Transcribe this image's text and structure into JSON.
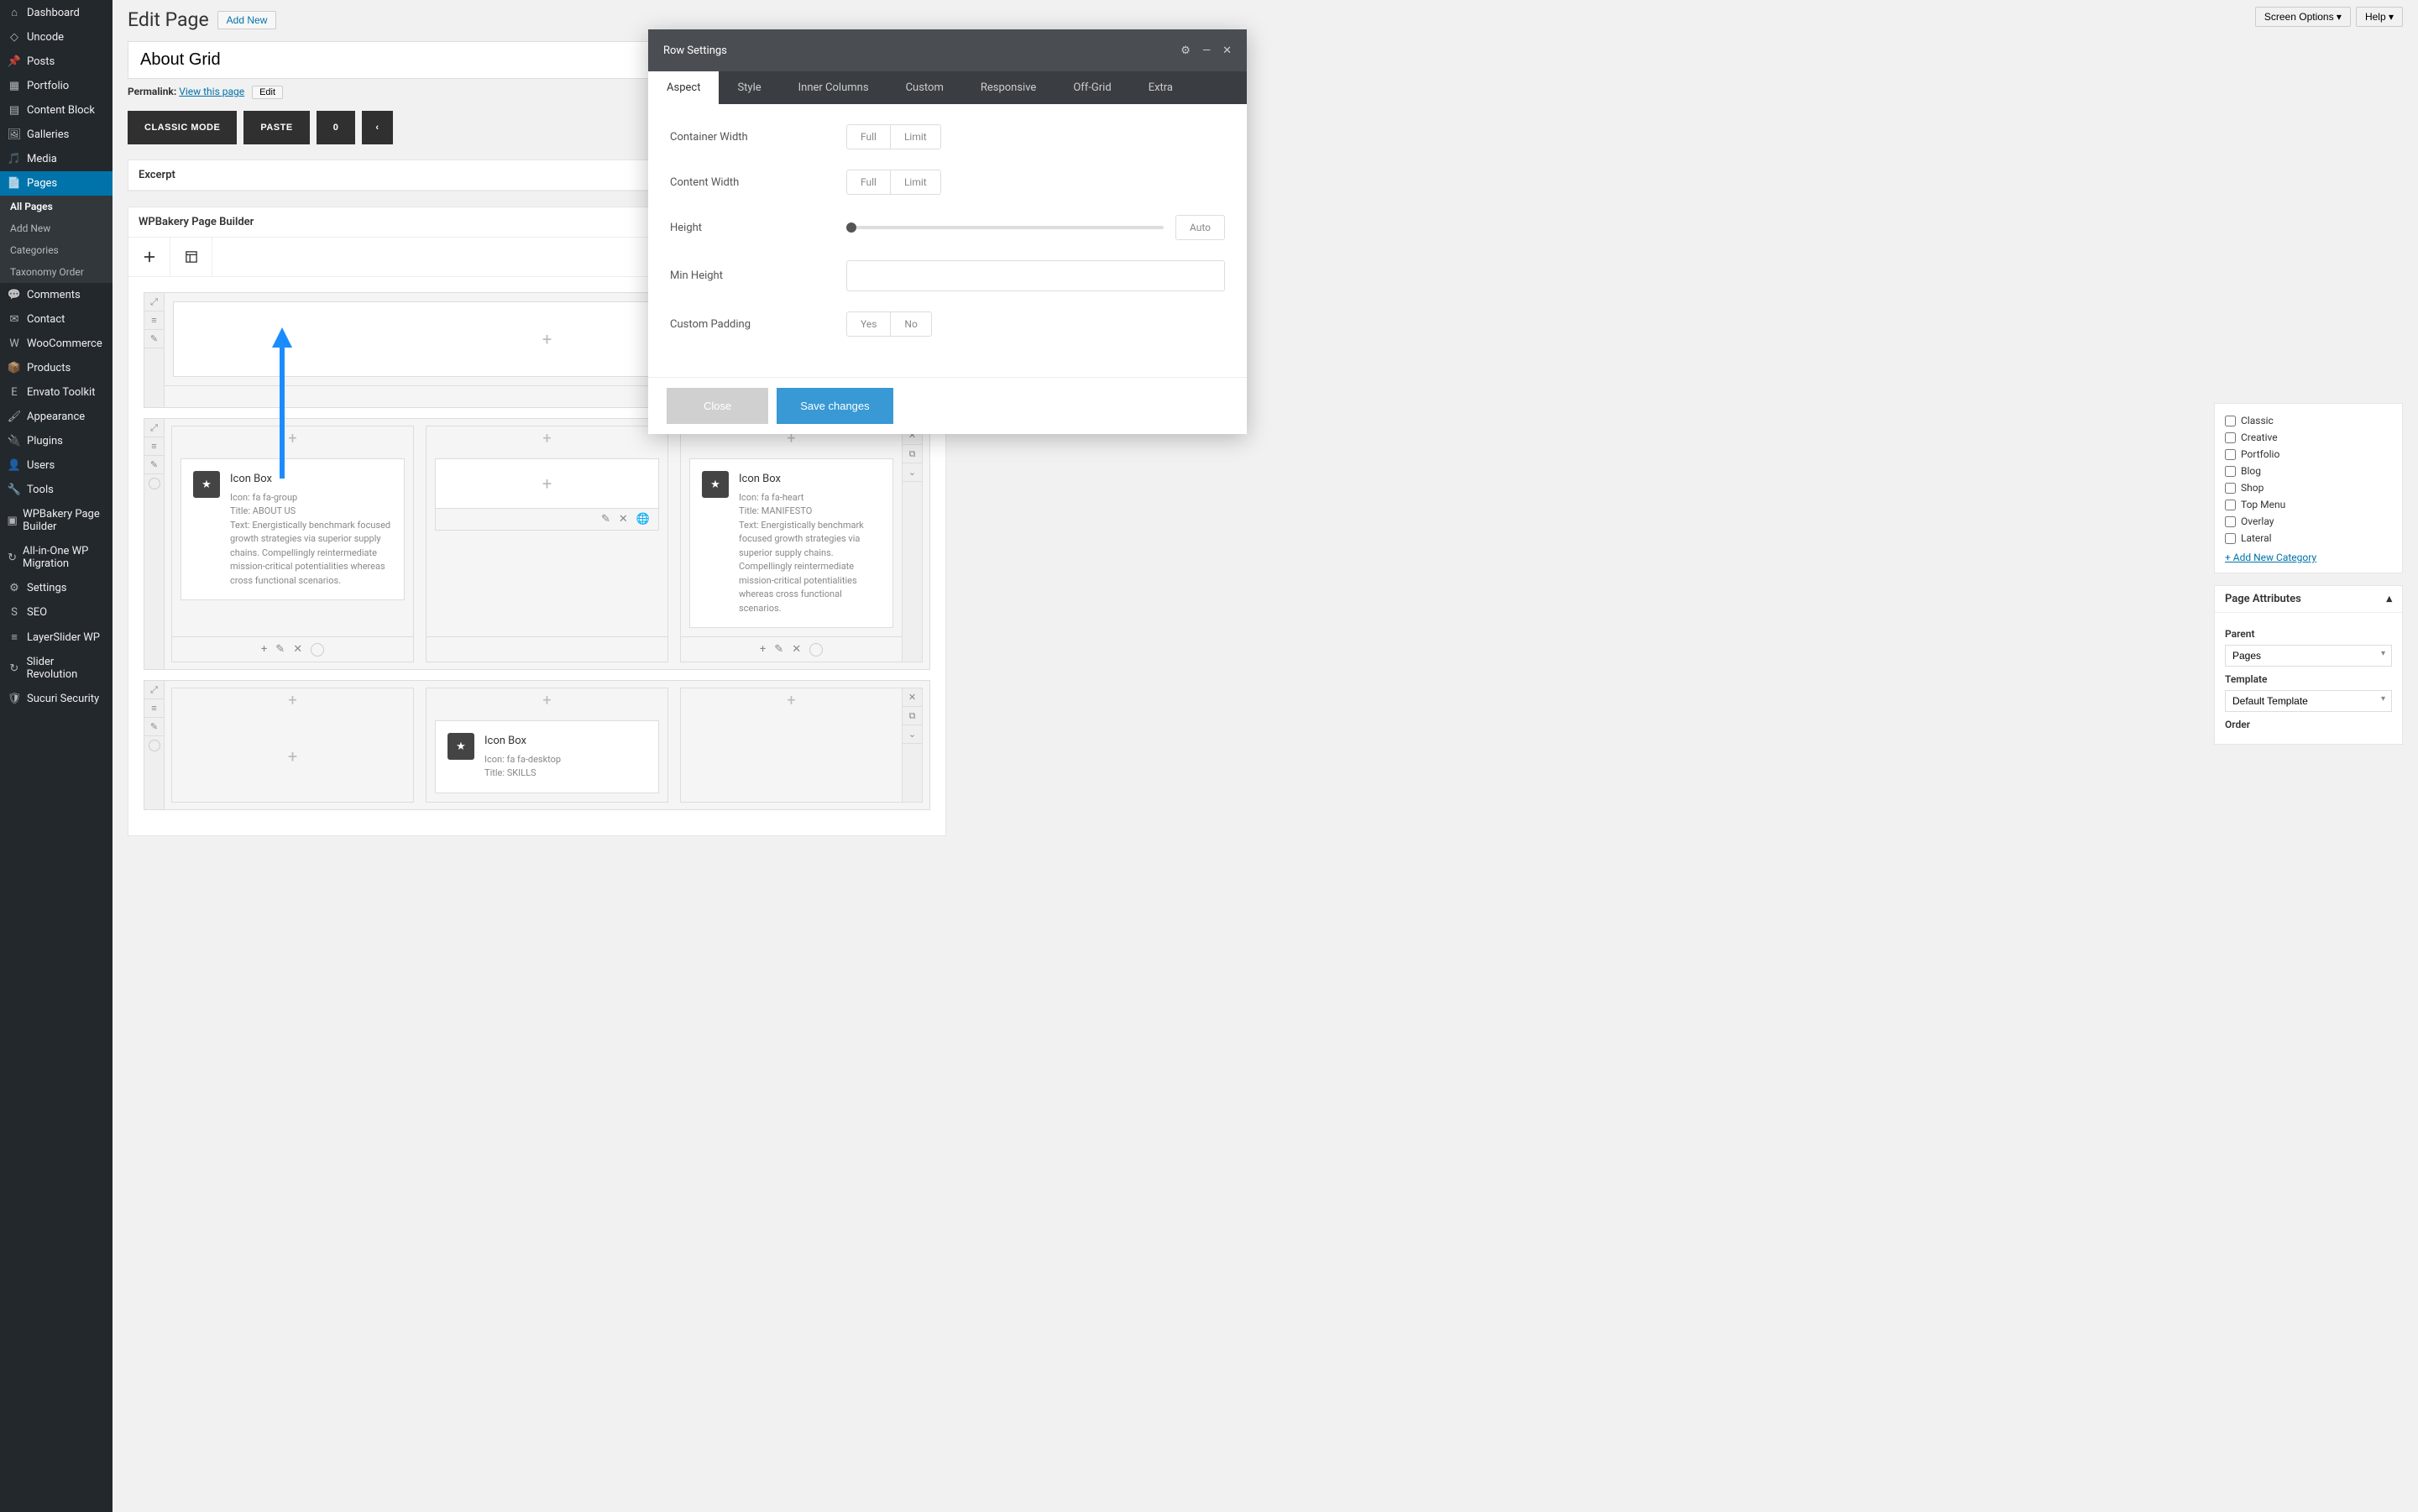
{
  "topbar": {
    "screen_options": "Screen Options",
    "help": "Help"
  },
  "sidebar": {
    "items": [
      {
        "label": "Dashboard",
        "icon": "dashboard"
      },
      {
        "label": "Uncode",
        "icon": "uncode"
      },
      {
        "label": "Posts",
        "icon": "pin"
      },
      {
        "label": "Portfolio",
        "icon": "grid"
      },
      {
        "label": "Content Block",
        "icon": "block"
      },
      {
        "label": "Galleries",
        "icon": "gallery"
      },
      {
        "label": "Media",
        "icon": "media"
      },
      {
        "label": "Pages",
        "icon": "page",
        "active": true
      },
      {
        "label": "Comments",
        "icon": "comment"
      },
      {
        "label": "Contact",
        "icon": "contact"
      },
      {
        "label": "WooCommerce",
        "icon": "woo"
      },
      {
        "label": "Products",
        "icon": "products"
      },
      {
        "label": "Envato Toolkit",
        "icon": "envato"
      },
      {
        "label": "Appearance",
        "icon": "brush"
      },
      {
        "label": "Plugins",
        "icon": "plug"
      },
      {
        "label": "Users",
        "icon": "users"
      },
      {
        "label": "Tools",
        "icon": "wrench"
      },
      {
        "label": "WPBakery Page Builder",
        "icon": "wpb"
      },
      {
        "label": "All-in-One WP Migration",
        "icon": "migration"
      },
      {
        "label": "Settings",
        "icon": "settings"
      },
      {
        "label": "SEO",
        "icon": "seo"
      },
      {
        "label": "LayerSlider WP",
        "icon": "layerslider"
      },
      {
        "label": "Slider Revolution",
        "icon": "revslider"
      },
      {
        "label": "Sucuri Security",
        "icon": "sucuri"
      }
    ],
    "sub": [
      {
        "label": "All Pages",
        "active": true
      },
      {
        "label": "Add New"
      },
      {
        "label": "Categories"
      },
      {
        "label": "Taxonomy Order"
      }
    ]
  },
  "page": {
    "heading": "Edit Page",
    "add_new": "Add New",
    "title_value": "About Grid",
    "permalink_label": "Permalink:",
    "permalink_text": "View this page",
    "edit": "Edit",
    "classic": "CLASSIC MODE",
    "paste": "PASTE",
    "undo_count": "0",
    "excerpt": "Excerpt",
    "builder": "WPBakery Page Builder"
  },
  "iconbox": {
    "title": "Icon Box",
    "a_icon": "Icon: fa fa-group",
    "a_title": "Title: ABOUT US",
    "a_text": "Text: Energistically benchmark focused growth strategies via superior supply chains. Compellingly reintermediate mission-critical potentialities whereas cross functional scenarios.",
    "b_icon": "Icon: fa fa-heart",
    "b_title": "Title: MANIFESTO",
    "b_text": "Text: Energistically benchmark focused growth strategies via superior supply chains. Compellingly reintermediate mission-critical potentialities whereas cross functional scenarios.",
    "c_icon": "Icon: fa fa-desktop",
    "c_title": "Title: SKILLS"
  },
  "categories": {
    "items": [
      "Classic",
      "Creative",
      "Portfolio",
      "Blog",
      "Shop",
      "Top Menu",
      "Overlay",
      "Lateral"
    ],
    "add_link": "+ Add New Category"
  },
  "attributes": {
    "header": "Page Attributes",
    "parent_label": "Parent",
    "parent_value": "Pages",
    "template_label": "Template",
    "template_value": "Default Template",
    "order_label": "Order"
  },
  "modal": {
    "title": "Row Settings",
    "tabs": [
      "Aspect",
      "Style",
      "Inner Columns",
      "Custom",
      "Responsive",
      "Off-Grid",
      "Extra"
    ],
    "active_tab": 0,
    "container_width": "Container Width",
    "content_width": "Content Width",
    "height": "Height",
    "min_height": "Min Height",
    "custom_padding": "Custom Padding",
    "full": "Full",
    "limit": "Limit",
    "auto": "Auto",
    "yes": "Yes",
    "no": "No",
    "close": "Close",
    "save": "Save changes"
  }
}
